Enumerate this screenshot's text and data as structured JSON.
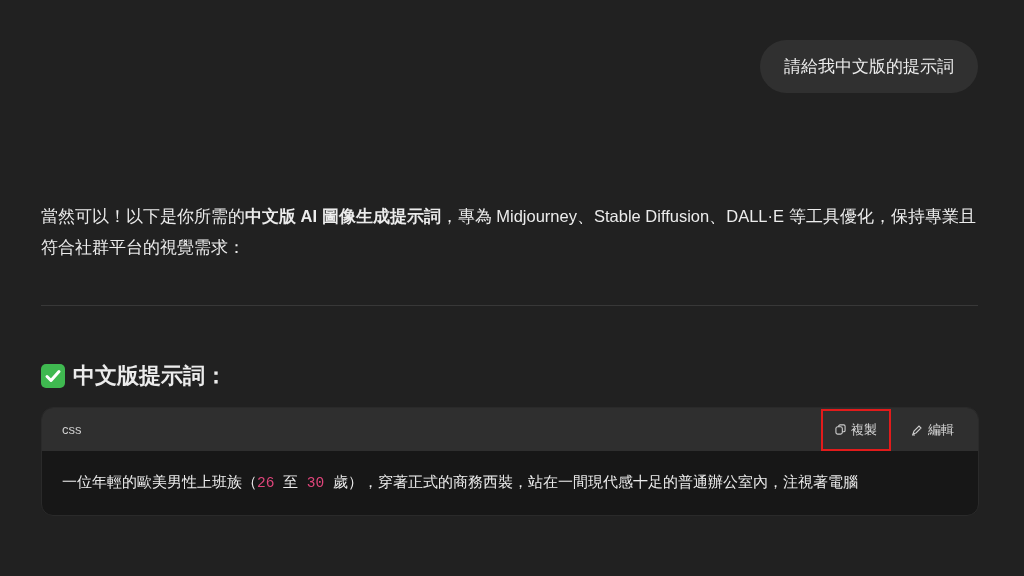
{
  "user_message": {
    "text": "請給我中文版的提示詞"
  },
  "reply": {
    "intro": "當然可以！以下是你所需的**中文版 AI 圖像生成提示詞**，專為 Midjourney、Stable Diffusion、DALL·E 等工具優化，保持專業且符合社群平台的視覺需求：",
    "heading": "中文版提示詞：",
    "code_block": {
      "language": "css",
      "copy_button": {
        "label": "複製",
        "highlighted": true
      },
      "edit_button": {
        "label": "編輯"
      },
      "code": [
        {
          "kind": "text",
          "text": "一位年輕的歐美男性上班族（"
        },
        {
          "kind": "number",
          "text": "26"
        },
        {
          "kind": "text",
          "text": " 至 "
        },
        {
          "kind": "number",
          "text": "30"
        },
        {
          "kind": "text",
          "text": " 歲），穿著正式的商務西裝，站在一間現代感十足的普通辦公室內，注視著電腦"
        }
      ]
    }
  }
}
